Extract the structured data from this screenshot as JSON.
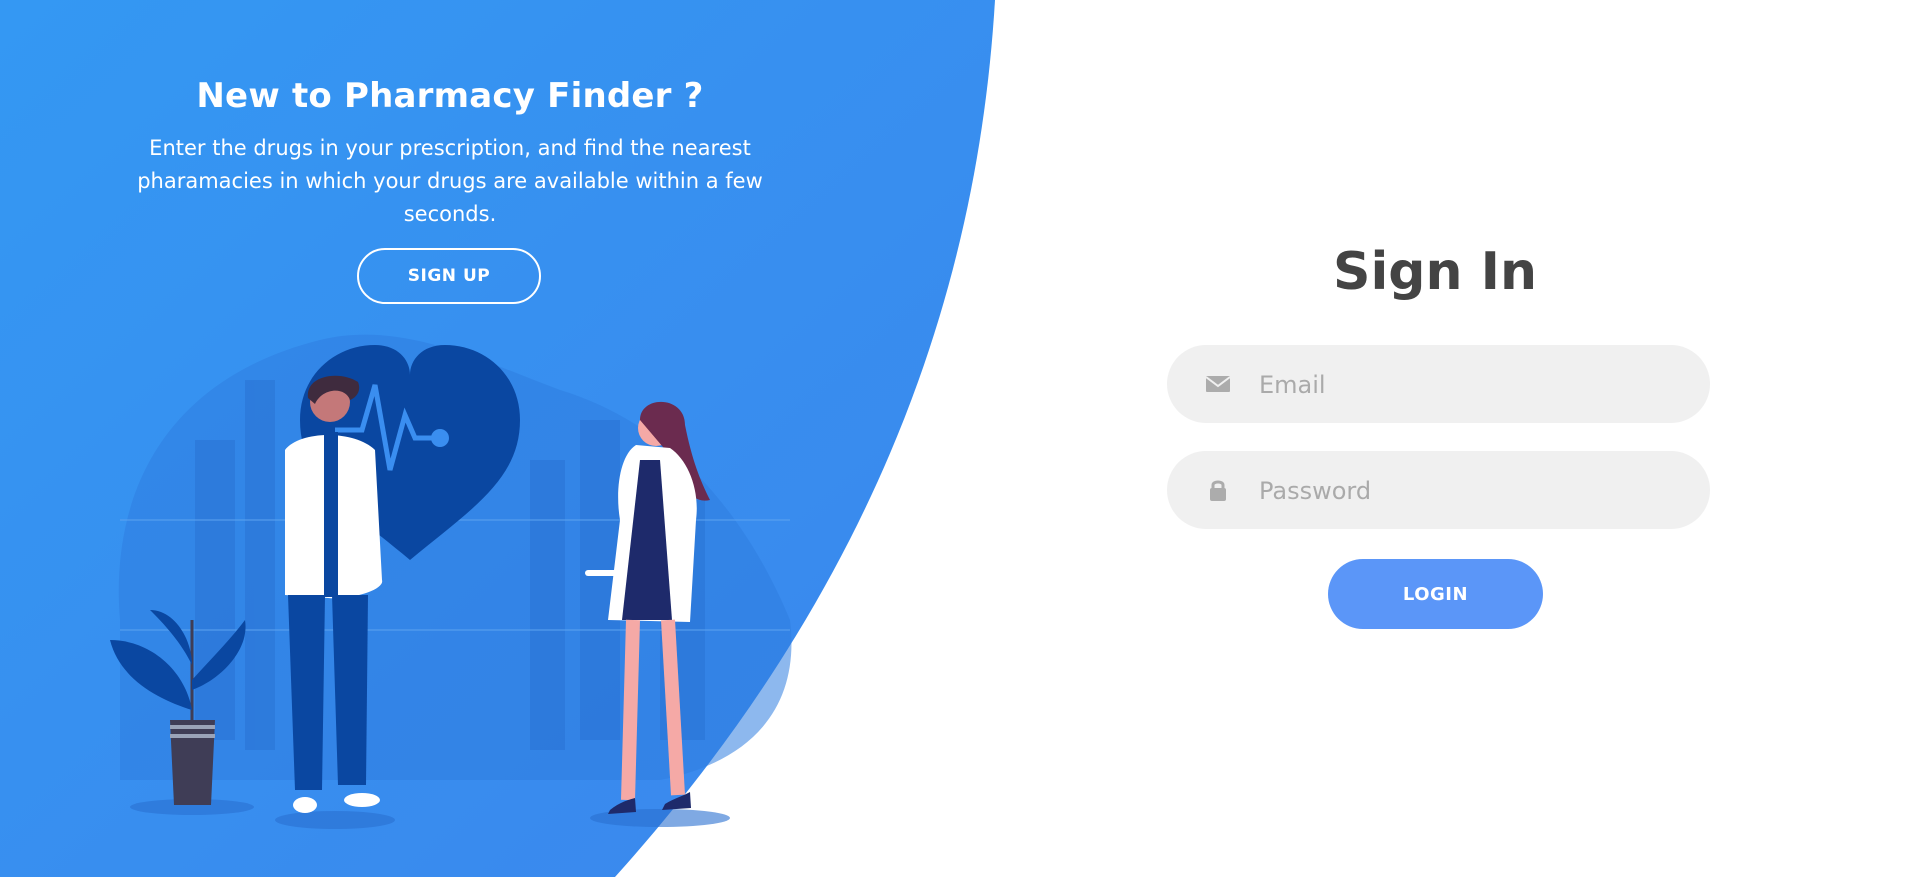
{
  "theme": {
    "primary_blue": "#3a8ef0",
    "dark_blue": "#0a47a1",
    "login_button": "#5b96f8",
    "input_background": "#f0f0f0",
    "heading_text": "#444444"
  },
  "promo": {
    "title": "New to Pharmacy Finder ?",
    "description": "Enter the drugs in your prescription, and find the nearest pharamacies in which your drugs are available within a few seconds.",
    "signup_label": "SIGN UP"
  },
  "signin": {
    "title": "Sign In",
    "email_placeholder": "Email",
    "email_icon": "envelope-icon",
    "password_placeholder": "Password",
    "password_icon": "lock-icon",
    "login_label": "LOGIN"
  }
}
